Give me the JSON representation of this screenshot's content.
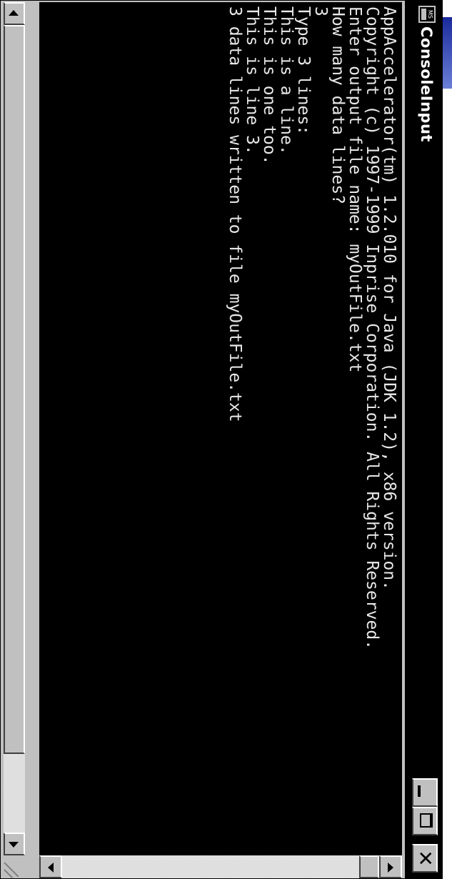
{
  "window": {
    "title": "ConsoleInput",
    "icon": "ms-dos-icon",
    "icon_text": "MS",
    "controls": {
      "minimize_icon": "minimize-icon",
      "maximize_icon": "maximize-icon",
      "close_icon": "close-icon",
      "close_glyph": "✕"
    }
  },
  "console": {
    "lines": [
      "AppAccelerator(tm) 1.2.010 for Java (JDK 1.2), x86 version.",
      "Copyright (c) 1997-1999 Inprise Corporation. All Rights Reserved.",
      "Enter output file name: myOutFile.txt",
      "How many data lines?",
      "3",
      "Type 3 lines:",
      "This is a line.",
      "This is one too.",
      "This is line 3.",
      "3 data lines written to file myOutFile.txt"
    ],
    "background": "#000000",
    "foreground": "#e8e8e8"
  },
  "scrollbars": {
    "vertical": {
      "up_icon": "arrow-up-icon",
      "down_icon": "arrow-down-icon"
    },
    "horizontal": {
      "left_icon": "arrow-left-icon",
      "right_icon": "arrow-right-icon"
    }
  },
  "colors": {
    "chrome": "#c0c0c0",
    "titlebar": "#000000",
    "desktop_accent": "#1a2a9c"
  }
}
